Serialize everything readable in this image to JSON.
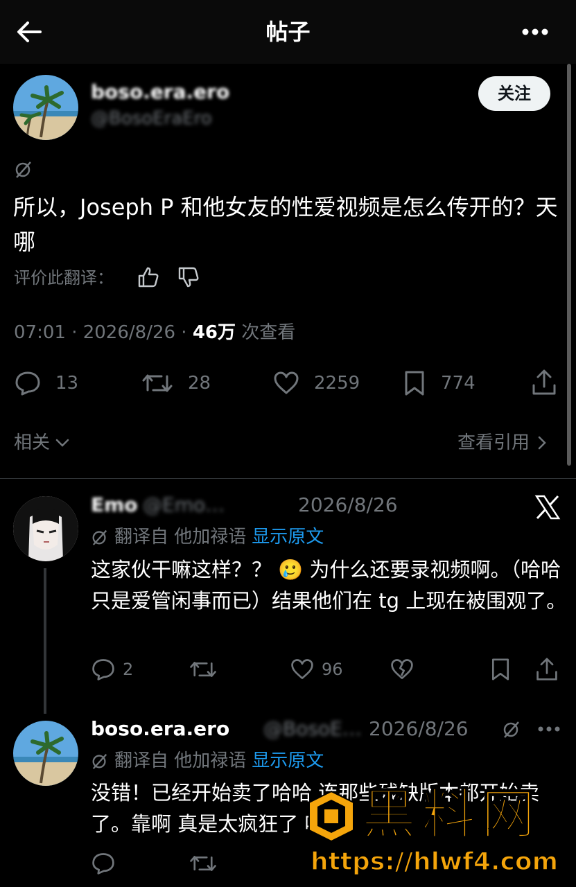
{
  "header": {
    "title": "帖子"
  },
  "post": {
    "author_name": "boso.era.ero",
    "author_handle": "@BosoEraEro",
    "follow_label": "关注",
    "text": "所以，Joseph P 和他女友的性爱视频是怎么传开的？天哪",
    "rate_label": "评价此翻译：",
    "time": "07:01 · 2026/8/26 · ",
    "views": "46万",
    "views_suffix": " 次查看",
    "stats": {
      "replies": "13",
      "reposts": "28",
      "likes": "2259",
      "bookmarks": "774"
    },
    "related_label": "相关",
    "quotes_label": "查看引用"
  },
  "replies": [
    {
      "name": "Emo",
      "handle": "@Emo…",
      "date": "2026/8/26",
      "translated_from": "翻译自 他加禄语",
      "show_original": "显示原文",
      "text": "这家伙干嘛这样？？ 🥲 为什么还要录视频啊。（哈哈只是爱管闲事而已）结果他们在 tg 上现在被围观了。",
      "stats": {
        "replies": "2",
        "likes": "96"
      }
    },
    {
      "name": "boso.era.ero",
      "handle": "@BosoE…",
      "date": "2026/8/26",
      "translated_from": "翻译自 他加禄语",
      "show_original": "显示原文",
      "text": "没错！已经开始卖了哈哈 连那些残缺版本都开始卖了。靠啊 真是太疯狂了 哈哈"
    }
  ],
  "watermark": {
    "brand": "黑料网",
    "url": "https://hlwf4.com"
  },
  "colors": {
    "accent": "#1d9bf0",
    "muted": "#71767b",
    "watermark": "#f5a50b"
  }
}
